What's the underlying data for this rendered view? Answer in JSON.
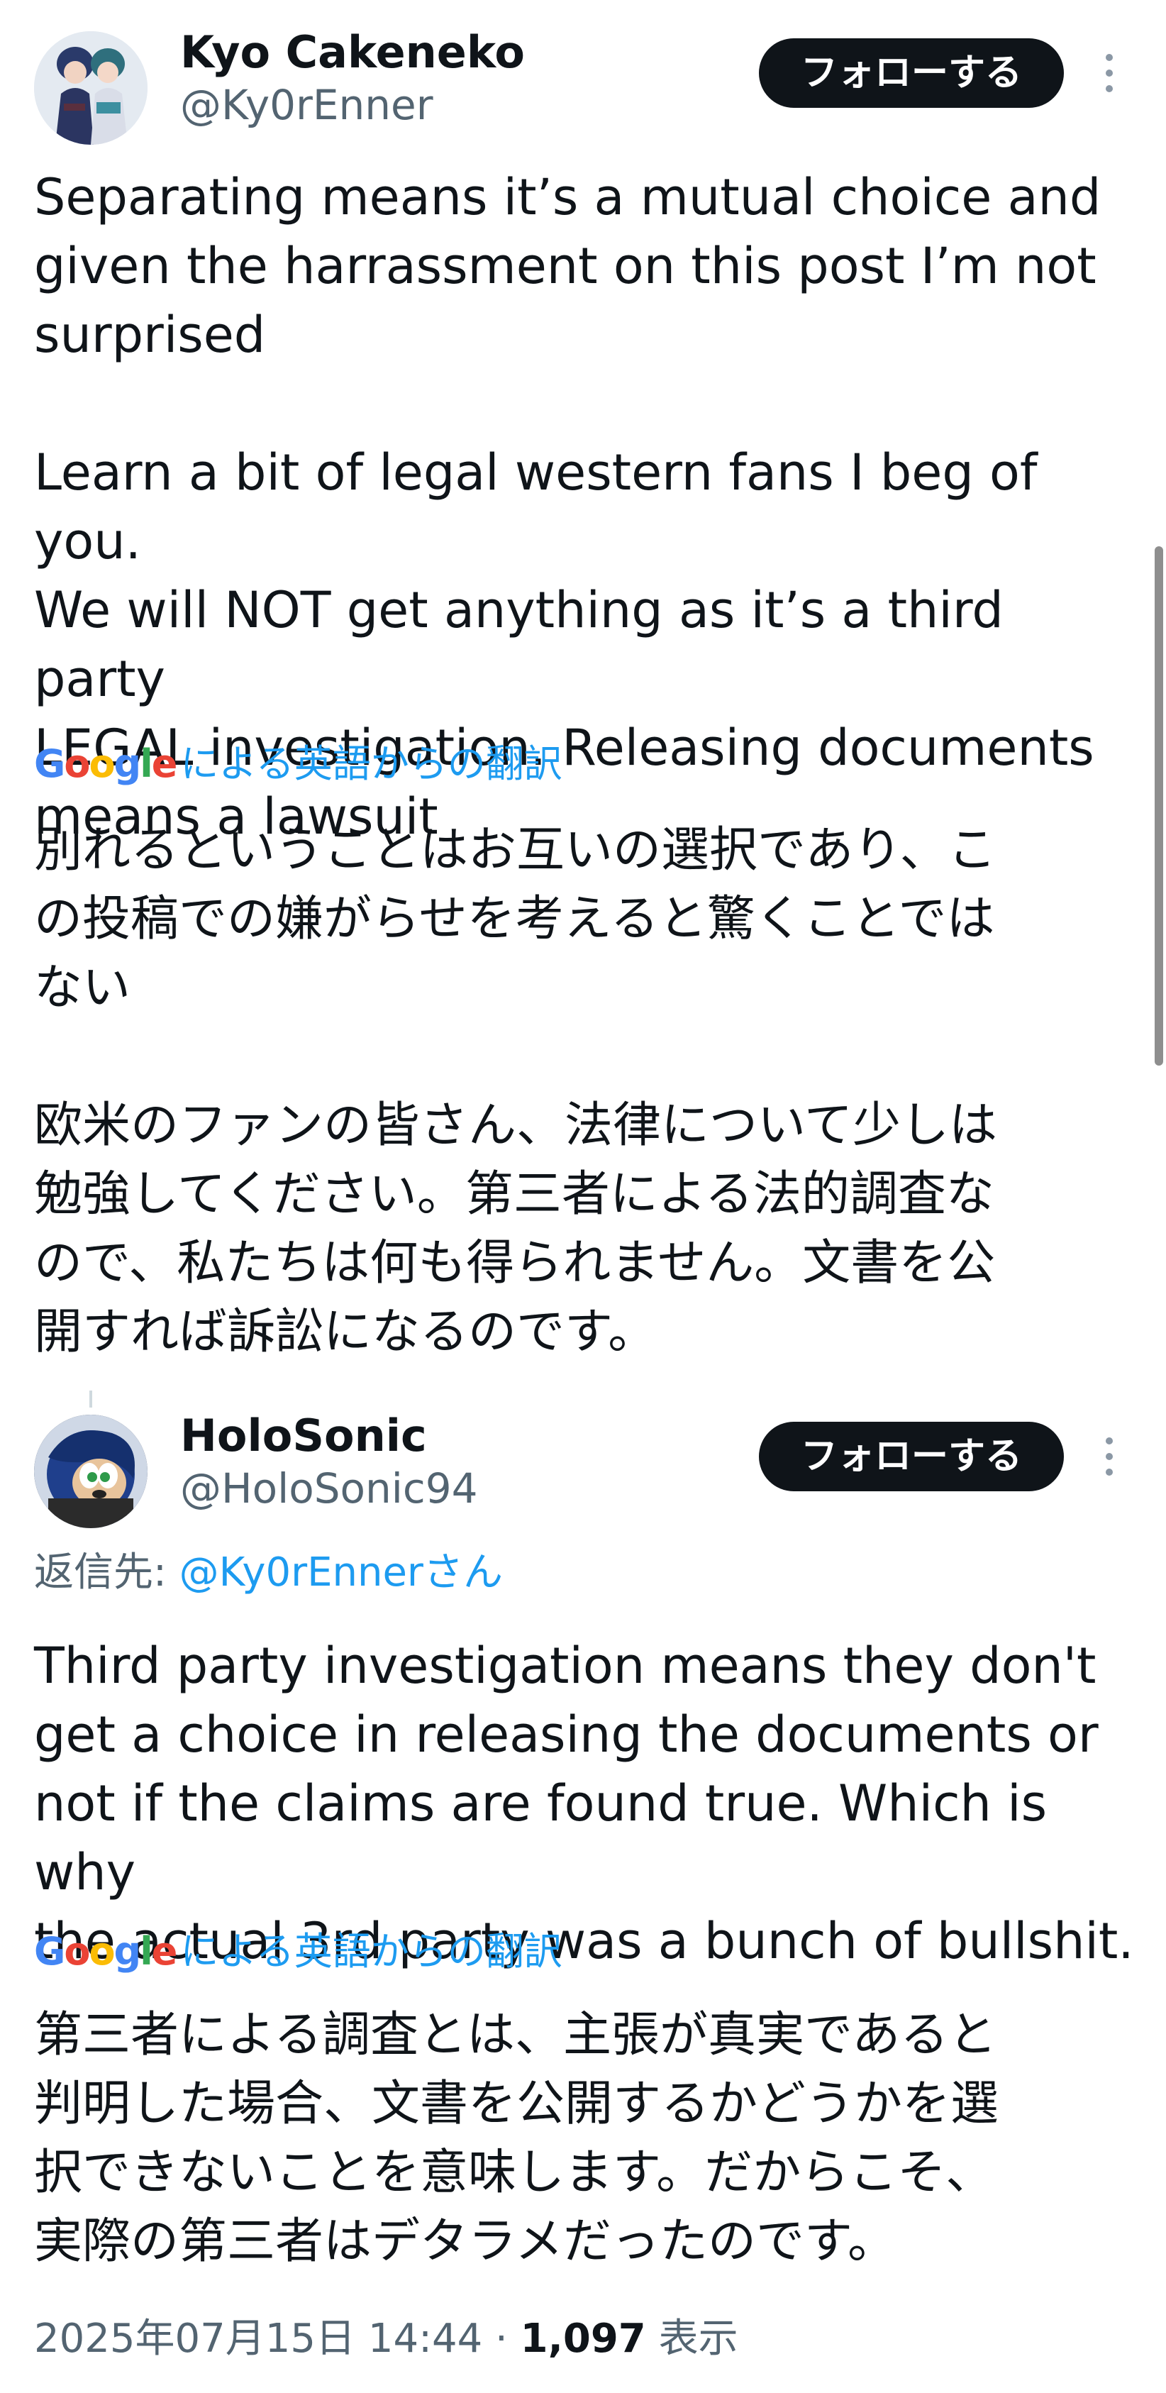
{
  "tweets": [
    {
      "author_name": "Kyo Cakeneko",
      "handle": "@Ky0rEnner",
      "follow_label": "フォローする",
      "text_en": "Separating means it’s a mutual choice and\ngiven the harrassment on this post I’m not\nsurprised\n\nLearn a bit of legal western fans I beg of you.\nWe will NOT get anything as it’s a third party\nLEGAL investigation. Releasing documents\nmeans a lawsuit",
      "translation_label": "による英語からの翻訳",
      "text_ja": "別れるということはお互いの選択であり、こ\nの投稿での嫌がらせを考えると驚くことでは\nない\n\n欧米のファンの皆さん、法律について少しは\n勉強してください。第三者による法的調査な\nので、私たちは何も得られません。文書を公\n開すれば訴訟になるのです。"
    },
    {
      "author_name": "HoloSonic",
      "handle": "@HoloSonic94",
      "follow_label": "フォローする",
      "reply_prefix": "返信先: ",
      "reply_mention": "@Ky0rEnnerさん",
      "text_en": "Third party investigation means they don't\nget a choice in releasing the documents or\nnot if the claims are found true. Which is why\nthe actual 3rd party was a bunch of bullshit.",
      "translation_label": "による英語からの翻訳",
      "text_ja": "第三者による調査とは、主張が真実であると\n判明した場合、文書を公開するかどうかを選\n択できないことを意味します。だからこそ、\n実際の第三者はデタラメだったのです。"
    }
  ],
  "google_logo_text": [
    "G",
    "o",
    "o",
    "g",
    "l",
    "e"
  ],
  "meta": {
    "timestamp": "2025年07月15日 14:44",
    "separator": " · ",
    "views_count": "1,097",
    "views_label": " 表示"
  },
  "icons": [
    "more-options-icon",
    "avatar-image",
    "google-logo"
  ]
}
